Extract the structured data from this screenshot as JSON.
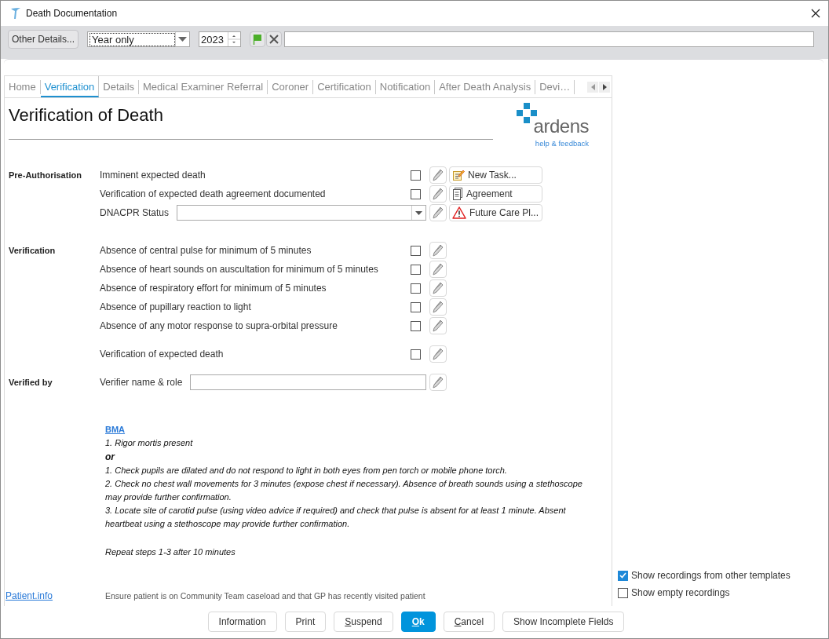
{
  "window": {
    "title": "Death Documentation"
  },
  "toolbar": {
    "other_details": "Other Details...",
    "date_precision": "Year only",
    "year": "2023"
  },
  "tabs": [
    {
      "label": "Home",
      "selected": false
    },
    {
      "label": "Verification",
      "selected": true
    },
    {
      "label": "Details",
      "selected": false
    },
    {
      "label": "Medical Examiner Referral",
      "selected": false
    },
    {
      "label": "Coroner",
      "selected": false
    },
    {
      "label": "Certification",
      "selected": false
    },
    {
      "label": "Notification",
      "selected": false
    },
    {
      "label": "After Death Analysis",
      "selected": false
    },
    {
      "label": "Devi…",
      "selected": false
    }
  ],
  "header": {
    "title": "Verification of Death",
    "logo": "ardens",
    "help_link": "help & feedback"
  },
  "sections": [
    {
      "title": "Pre-Authorisation",
      "groups": [
        [
          {
            "kind": "check",
            "label": "Imminent expected death",
            "checked": false,
            "action": {
              "label": "New Task...",
              "kind": "task"
            }
          },
          {
            "kind": "check",
            "label": "Verification of expected death agreement documented",
            "checked": false,
            "action": {
              "label": "Agreement",
              "kind": "document"
            }
          },
          {
            "kind": "select",
            "label": "DNACPR Status",
            "action": {
              "label": "Future Care Pl...",
              "kind": "warning"
            }
          }
        ]
      ]
    },
    {
      "title": "Verification",
      "groups": [
        [
          {
            "kind": "check",
            "label": "Absence of central pulse for minimum of 5 minutes",
            "checked": false
          },
          {
            "kind": "check",
            "label": "Absence of heart sounds on auscultation for minimum of 5 minutes",
            "checked": false
          },
          {
            "kind": "check",
            "label": "Absence of respiratory effort for minimum of 5 minutes",
            "checked": false
          },
          {
            "kind": "check",
            "label": "Absence of pupillary reaction to light",
            "checked": false
          },
          {
            "kind": "check",
            "label": "Absence of any motor response to supra-orbital pressure",
            "checked": false
          }
        ],
        [
          {
            "kind": "check",
            "label": "Verification of expected death",
            "checked": false
          }
        ]
      ]
    },
    {
      "title": "Verified by",
      "groups": [
        [
          {
            "kind": "text",
            "label": "Verifier name & role"
          }
        ]
      ]
    }
  ],
  "guidance": {
    "link": "BMA",
    "lines": [
      {
        "kind": "step",
        "text": "1. Rigor mortis present"
      },
      {
        "kind": "strong",
        "text": "or"
      },
      {
        "kind": "step",
        "text": "1. Check pupils are dilated and do not respond to light in both eyes from pen torch or mobile phone torch."
      },
      {
        "kind": "step",
        "text": "2. Check no chest wall movements for 3 minutes (expose chest if necessary). Absence of breath sounds using a stethoscope may provide further confirmation."
      },
      {
        "kind": "step",
        "text": "3. Locate site of carotid pulse (using video advice if required) and check that pulse is absent for at least 1 minute. Absent heartbeat using a stethoscope may provide further confirmation."
      },
      {
        "kind": "note",
        "text": "Repeat steps 1-3 after 10 minutes"
      }
    ]
  },
  "patient_info_link": "Patient.info",
  "footer_note": "Ensure patient is on Community Team caseload and that GP has recently visited patient",
  "options": [
    {
      "label": "Show recordings from other templates",
      "checked": true
    },
    {
      "label": "Show empty recordings",
      "checked": false
    }
  ],
  "buttons": [
    {
      "label": "Information",
      "primary": false,
      "underline_first": false
    },
    {
      "label": "Print",
      "primary": false,
      "underline_first": false
    },
    {
      "label": "Suspend",
      "primary": false,
      "underline_first": true
    },
    {
      "label": "Ok",
      "primary": true,
      "underline_first": true
    },
    {
      "label": "Cancel",
      "primary": false,
      "underline_first": true
    },
    {
      "label": "Show Incomplete Fields",
      "primary": false,
      "underline_first": false
    }
  ]
}
